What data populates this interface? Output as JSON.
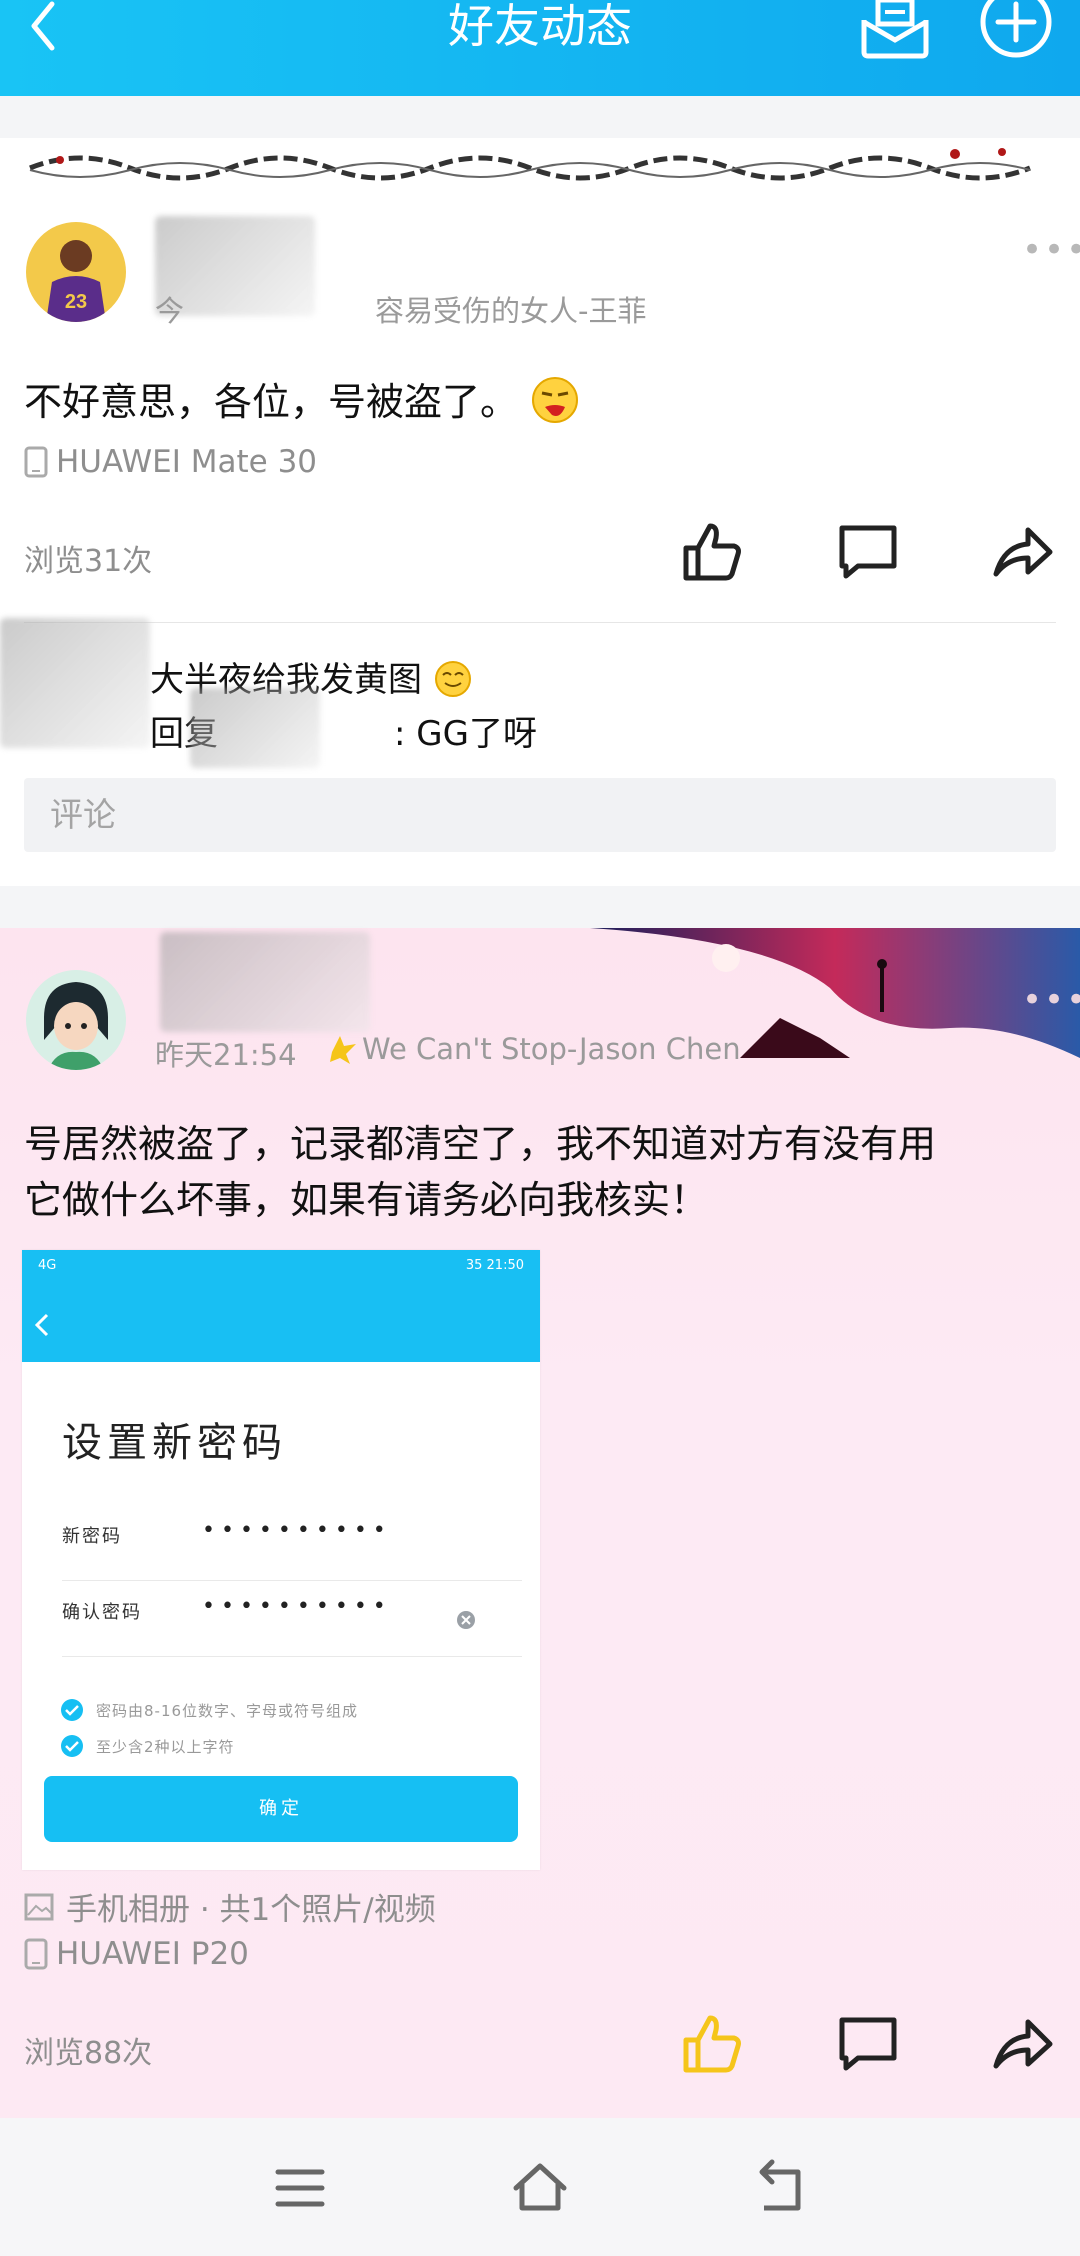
{
  "header": {
    "title": "好友动态",
    "back_icon": "chevron-left-icon",
    "mail_icon": "mail-icon",
    "add_icon": "plus-circle-icon"
  },
  "post1": {
    "author": "",
    "time_prefix": "今",
    "song": "容易受伤的女人-王菲",
    "content": "不好意思，各位，号被盗了。",
    "device": "HUAWEI Mate 30",
    "views": "浏览31次",
    "comments": [
      {
        "author": "",
        "text": "大半夜给我发黄图"
      },
      {
        "author": "",
        "reply_word": "回复",
        "reply_to": "",
        "text": ": GG了呀"
      }
    ],
    "comment_placeholder": "评论"
  },
  "post2": {
    "author": "",
    "time": "昨天21:54",
    "song": "We Can't Stop-Jason Chen",
    "content_line1": "号居然被盗了，记录都清空了，我不知道对方有没有用",
    "content_line2": "它做什么坏事，如果有请务必向我核实！",
    "screenshot": {
      "status_left": "4G",
      "status_right": "35  21:50",
      "title": "设置新密码",
      "new_pw_label": "新密码",
      "confirm_pw_label": "确认密码",
      "pw_dots": "••••••••••",
      "rule1": "密码由8-16位数字、字母或符号组成",
      "rule2": "至少含2种以上字符",
      "confirm_button": "确定"
    },
    "album": "手机相册 · 共1个照片/视频",
    "device": "HUAWEI P20",
    "views": "浏览88次"
  },
  "colors": {
    "header": "#19c4f5",
    "like_active": "#f5c51a",
    "text_gray": "#8e8e8e"
  }
}
